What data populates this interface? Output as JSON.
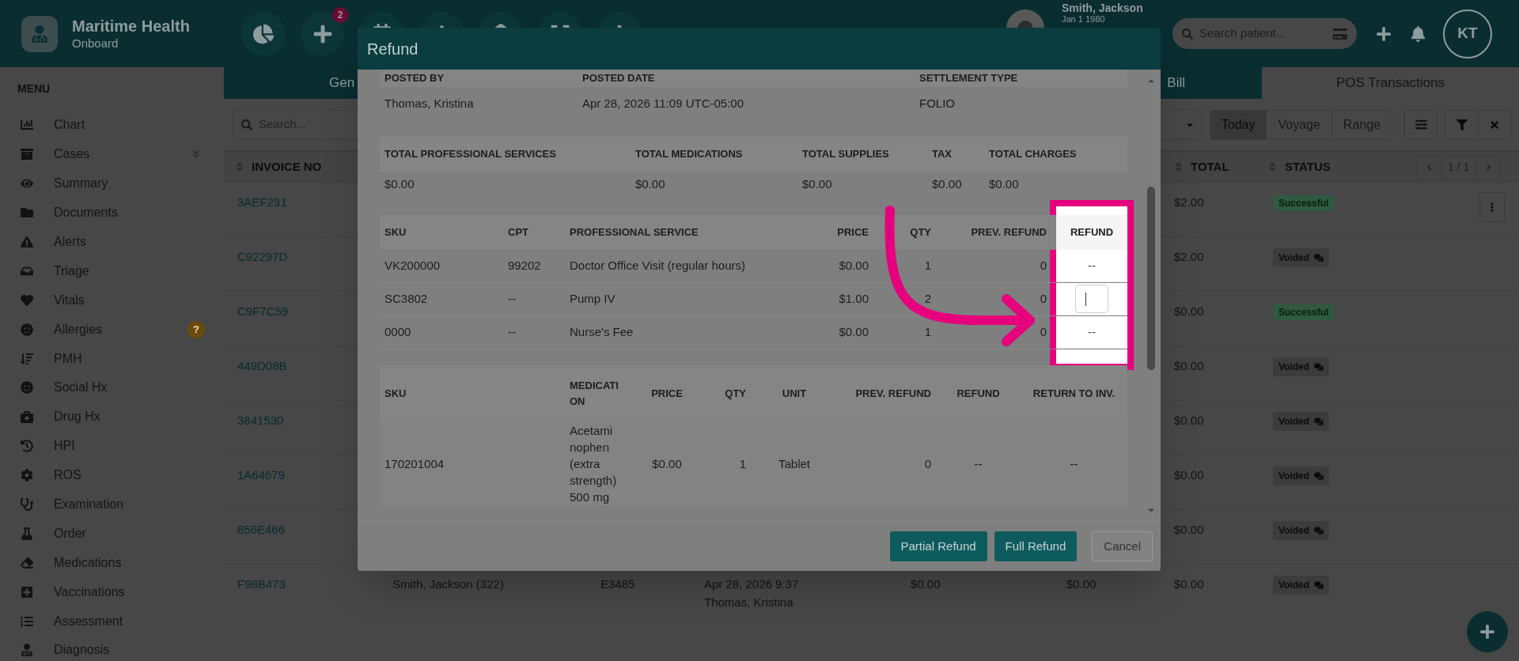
{
  "app": {
    "title": "Maritime Health",
    "subtitle": "Onboard"
  },
  "notification_badge": "2",
  "patient": {
    "name": "Smith, Jackson",
    "dob": "Jan 1 1980"
  },
  "patient_search": {
    "placeholder": "Search patient..."
  },
  "user": {
    "initials": "KT"
  },
  "sidebar": {
    "heading": "MENU",
    "items": [
      {
        "label": "Chart"
      },
      {
        "label": "Cases",
        "expanded": false
      },
      {
        "label": "Summary"
      },
      {
        "label": "Documents"
      },
      {
        "label": "Alerts"
      },
      {
        "label": "Triage"
      },
      {
        "label": "Vitals"
      },
      {
        "label": "Allergies",
        "badge": "?"
      },
      {
        "label": "PMH"
      },
      {
        "label": "Social Hx"
      },
      {
        "label": "Drug Hx"
      },
      {
        "label": "HPI"
      },
      {
        "label": "ROS"
      },
      {
        "label": "Examination"
      },
      {
        "label": "Order"
      },
      {
        "label": "Medications"
      },
      {
        "label": "Vaccinations"
      },
      {
        "label": "Assessment"
      },
      {
        "label": "Diagnosis"
      }
    ]
  },
  "tabs": [
    {
      "label": "Gen",
      "selected": false
    },
    {
      "label": "Bill",
      "selected": false
    },
    {
      "label": "POS Transactions",
      "selected": true
    }
  ],
  "search": {
    "placeholder": "Search..."
  },
  "range_buttons": [
    {
      "label": "Today",
      "selected": true
    },
    {
      "label": "Voyage",
      "selected": false
    },
    {
      "label": "Range",
      "selected": false
    }
  ],
  "table": {
    "columns": {
      "invoice": "INVOICE NO",
      "total": "TOTAL",
      "status": "STATUS"
    },
    "pagination": "1 / 1",
    "rows": [
      {
        "invoice": "3AEF231",
        "total": "$2.00",
        "status": {
          "label": "Successful",
          "kind": "success"
        },
        "menu": true
      },
      {
        "invoice": "C92297D",
        "total": "$2.00",
        "status": {
          "label": "Voided",
          "kind": "voided"
        },
        "menu": false
      },
      {
        "invoice": "C9F7C59",
        "total": "$0.00",
        "status": {
          "label": "Successful",
          "kind": "success"
        },
        "menu": false
      },
      {
        "invoice": "449D08B",
        "total": "$0.00",
        "status": {
          "label": "Voided",
          "kind": "voided"
        },
        "menu": false
      },
      {
        "invoice": "3841530",
        "total": "$0.00",
        "status": {
          "label": "Voided",
          "kind": "voided"
        },
        "menu": false
      },
      {
        "invoice": "1A64679",
        "total": "$0.00",
        "status": {
          "label": "Voided",
          "kind": "voided"
        },
        "menu": false
      },
      {
        "invoice": "856E466",
        "total": "$0.00",
        "status": {
          "label": "Voided",
          "kind": "voided"
        },
        "menu": false
      },
      {
        "invoice": "F98B473",
        "column_2": "Smith, Jackson (322)",
        "column_3": "E3485",
        "column_4": [
          "Apr 28, 2026 9:37",
          "Thomas, Kristina"
        ],
        "column_5": "$0.00",
        "column_6": "$0.00",
        "total": "$0.00",
        "status": {
          "label": "Voided",
          "kind": "voided"
        },
        "menu": false
      }
    ]
  },
  "modal": {
    "title": "Refund",
    "posting": {
      "columns": [
        "POSTED BY",
        "POSTED DATE",
        "SETTLEMENT TYPE"
      ],
      "values": [
        "Thomas, Kristina",
        "Apr 28, 2026 11:09 UTC-05:00",
        "FOLIO"
      ]
    },
    "totals": {
      "columns": [
        "TOTAL PROFESSIONAL SERVICES",
        "TOTAL MEDICATIONS",
        "TOTAL SUPPLIES",
        "TAX",
        "TOTAL CHARGES"
      ],
      "values": [
        "$0.00",
        "$0.00",
        "$0.00",
        "$0.00",
        "$0.00"
      ]
    },
    "services": {
      "columns": [
        "SKU",
        "CPT",
        "PROFESSIONAL SERVICE",
        "PRICE",
        "QTY",
        "PREV. REFUND",
        "REFUND"
      ],
      "rows": [
        {
          "cells": [
            "VK200000",
            "99202",
            "Doctor Office Visit (regular hours)",
            "$0.00",
            "1",
            "0"
          ],
          "refund": {
            "kind": "text",
            "value": "--"
          }
        },
        {
          "cells": [
            "SC3802",
            "--",
            "Pump IV",
            "$1.00",
            "2",
            "0"
          ],
          "refund": {
            "kind": "input"
          }
        },
        {
          "cells": [
            "0000",
            "--",
            "Nurse's Fee",
            "$0.00",
            "1",
            "0"
          ],
          "refund": {
            "kind": "text",
            "value": "--"
          }
        }
      ]
    },
    "medications": {
      "columns": [
        "SKU",
        "MEDICATION",
        "PRICE",
        "QTY",
        "UNIT",
        "PREV. REFUND",
        "REFUND",
        "RETURN TO INV."
      ],
      "rows": [
        {
          "cells": [
            "170201004",
            "Acetaminophen (extra strength) 500 mg",
            "$0.00",
            "1",
            "Tablet",
            "0",
            "--",
            "--"
          ]
        }
      ]
    },
    "buttons": [
      {
        "label": "Partial Refund",
        "kind": "primary"
      },
      {
        "label": "Full Refund",
        "kind": "primary"
      },
      {
        "label": "Cancel",
        "kind": "secondary"
      }
    ]
  }
}
